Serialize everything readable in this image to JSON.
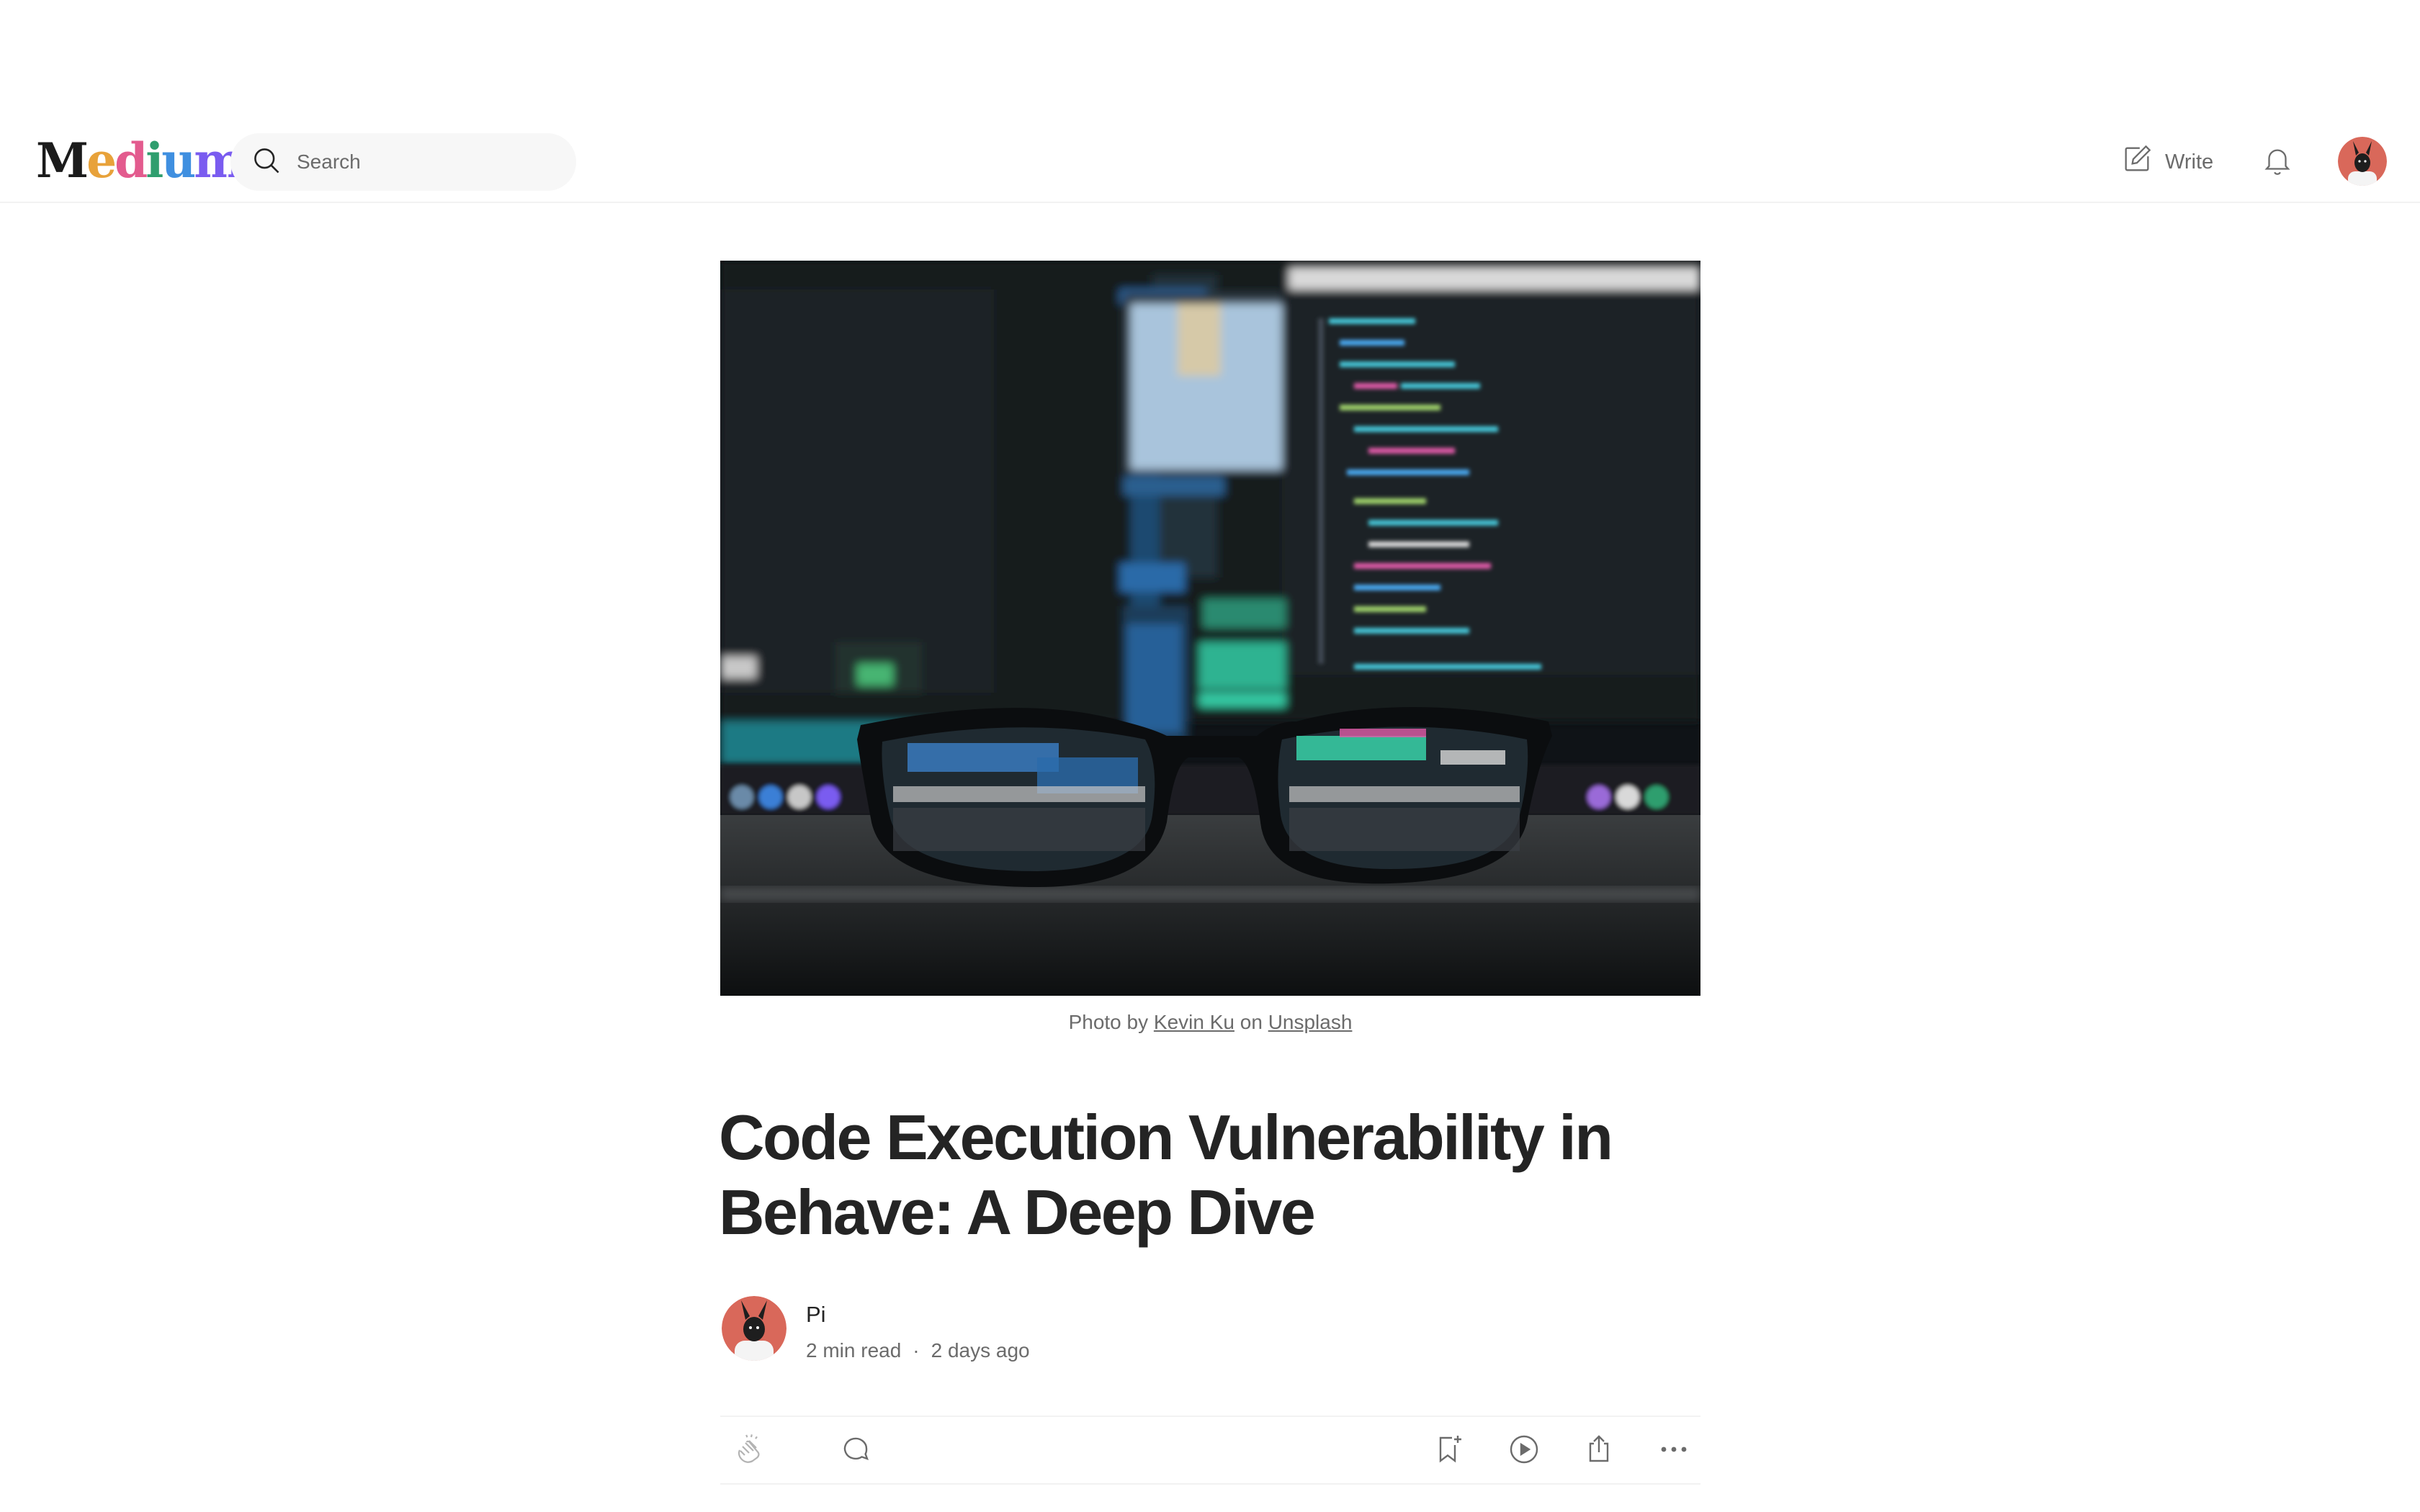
{
  "brand": {
    "name": "Medium"
  },
  "search": {
    "placeholder": "Search"
  },
  "nav": {
    "write_label": "Write"
  },
  "caption": {
    "prefix": "Photo by",
    "author": "Kevin Ku",
    "middle": "on",
    "source": "Unsplash"
  },
  "article": {
    "title": "Code Execution Vulnerability in Behave: A Deep Dive",
    "author": "Pi",
    "read_time": "2 min read",
    "separator": "·",
    "published": "2 days ago"
  },
  "icons": {
    "search": "search-icon",
    "write": "write-icon",
    "bell": "bell-icon",
    "clap": "clap-icon",
    "comment": "comment-icon",
    "bookmark": "bookmark-add-icon",
    "play": "play-icon",
    "share": "share-icon",
    "more": "more-icon"
  },
  "colors": {
    "text": "#242424",
    "muted": "#6b6b6b",
    "search_bg": "#f7f7f7",
    "divider": "#f2f2f2",
    "avatar_bg": "#d9685a"
  }
}
